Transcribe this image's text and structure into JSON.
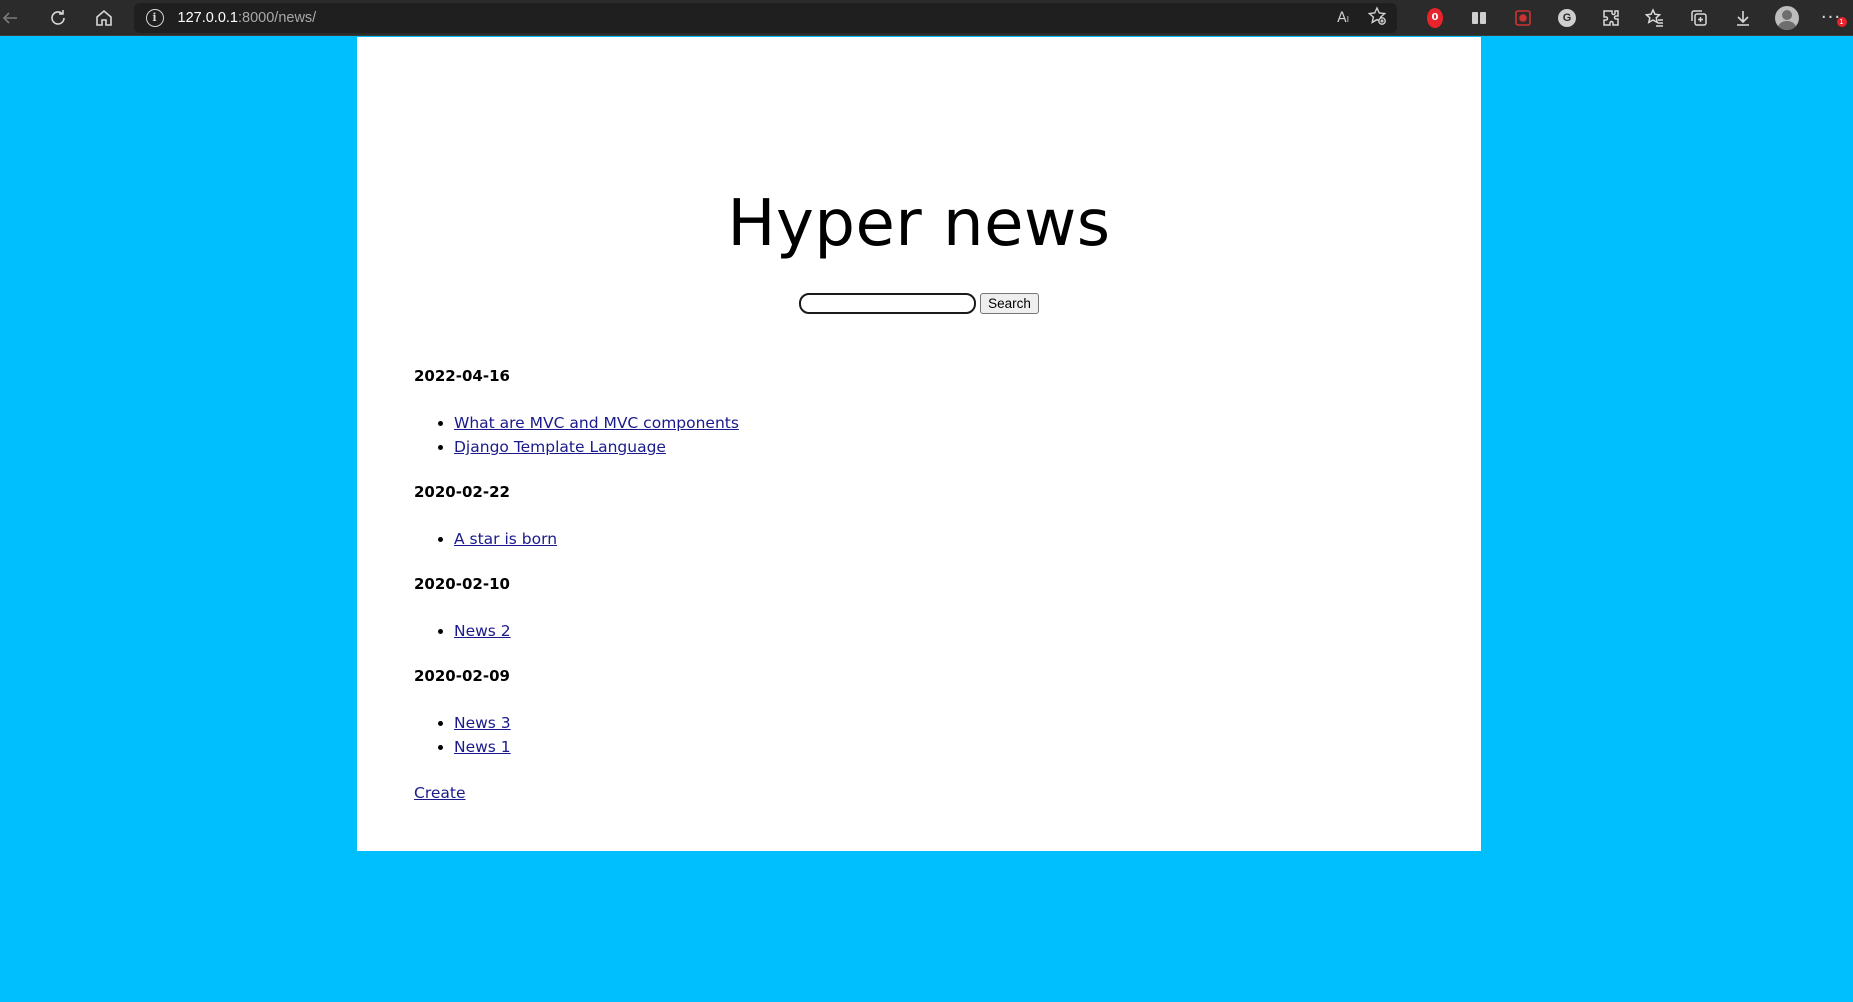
{
  "browser": {
    "url_host": "127.0.0.1",
    "url_path": ":8000/news/",
    "icons": {
      "back": "arrow-left-icon",
      "reload": "reload-icon",
      "home": "home-icon",
      "info": "info-icon",
      "read_aloud": "read-aloud-icon",
      "favorite": "add-favorite-icon",
      "ext_red": "extension-icon",
      "reading": "reading-list-icon",
      "capture": "screenshot-icon",
      "grammarly": "grammar-extension-icon",
      "extensions": "puzzle-icon",
      "favorites": "favorites-icon",
      "collections": "collections-icon",
      "downloads": "download-icon",
      "profile": "avatar",
      "more": "more-icon"
    },
    "read_aloud_glyph": "Aₗ",
    "info_glyph": "i",
    "grammar_glyph": "G",
    "more_glyph": "···",
    "more_badge": "1",
    "ext_badge_glyph": "0"
  },
  "page": {
    "title": "Hyper news",
    "search": {
      "input_value": "",
      "button_label": "Search"
    },
    "groups": [
      {
        "date": "2022-04-16",
        "items": [
          "What are MVC and MVC components",
          "Django Template Language"
        ]
      },
      {
        "date": "2020-02-22",
        "items": [
          "A star is born"
        ]
      },
      {
        "date": "2020-02-10",
        "items": [
          "News 2"
        ]
      },
      {
        "date": "2020-02-09",
        "items": [
          "News 3",
          "News 1"
        ]
      }
    ],
    "create_label": "Create"
  },
  "colors": {
    "page_background": "#00bfff",
    "card_background": "#ffffff",
    "link": "#1a1a8c",
    "browser_bar": "#2b2b2b"
  }
}
